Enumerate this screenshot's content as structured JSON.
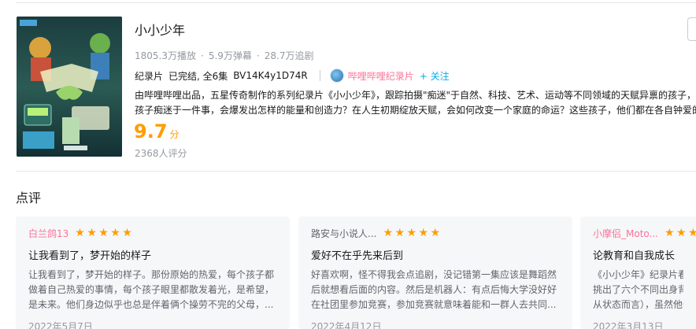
{
  "show": {
    "title": "小小少年",
    "plays": "1805.3万播放",
    "danmaku": "5.9万弹幕",
    "follows": "28.7万追剧",
    "dot": "·",
    "category": "纪录片",
    "status": "已完结, 全6集",
    "bvid": "BV14K4y1D74R",
    "uploader": "哔哩哔哩纪录片",
    "follow_label": "+ 关注",
    "desc_line1": "由哔哩哔哩出品，五星传奇制作的系列纪录片《小小少年》，跟踪拍摄\"痴迷\"于自然、科技、艺术、运动等不同领域的天赋异禀的孩子，",
    "desc_line2": "孩子痴迷于一件事，会爆发出怎样的能量和创造力？在人生初期绽放天赋，会如何改变一个家庭的命运？这些孩子，他们都在各自钟爱的",
    "score": "9.7",
    "score_unit": "分",
    "raters": "2368人评分"
  },
  "reviews_section": {
    "title": "点评"
  },
  "reviews": [
    {
      "user": "白兰鸽13",
      "rating": 5,
      "title": "让我看到了，梦开始的样子",
      "line1": "让我看到了，梦开始的样子。那份原始的热爱，每个孩子都",
      "line2": "做着自己热爱的事情，每个孩子眼里都散发着光，是希望，",
      "line3": "是未来。他们身边似乎也总是伴着俩个操劳不完的父母，...",
      "date": "2022年5月7日"
    },
    {
      "user": "路安与小说人...",
      "rating": 5,
      "title": "爱好不在乎先来后到",
      "line1": "好喜欢啊，怪不得我会点追剧，没记错第一集应该是舞蹈然",
      "line2": "后就想看后面的内容。然后是机器人：有点后悔大学没好好",
      "line3": "在社团里参加竞赛，参加竞赛就意味着能和一群人去共同...",
      "date": "2022年4月12日"
    },
    {
      "user": "小摩侣_Moto...",
      "rating": 5,
      "title": "论教育和自我成长",
      "line1": "《小小少年》纪录片看完",
      "line2": "挑出了六个不同出身背景",
      "line3": "从状态而言），虽然他们",
      "date": "2022年3月13日"
    }
  ],
  "colors": {
    "accent_pink": "#fb7299",
    "accent_blue": "#00aeec",
    "score_orange": "#ff9c00"
  },
  "icons": {
    "star": "star-icon",
    "avatar": "uploader-avatar"
  }
}
